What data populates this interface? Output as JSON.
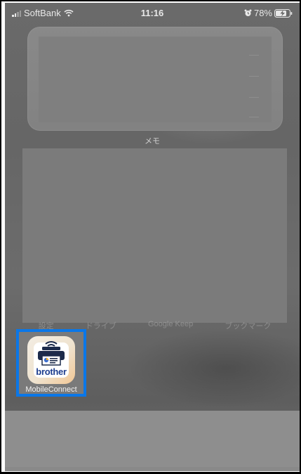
{
  "status_bar": {
    "carrier": "SoftBank",
    "time": "11:16",
    "battery_percent": "78%",
    "signal_bars_filled": 2,
    "signal_bars_total": 4,
    "icons": [
      "signal-icon",
      "wifi-icon",
      "alarm-icon",
      "battery-charging-icon"
    ]
  },
  "widgets": {
    "memo": {
      "label": "メモ"
    }
  },
  "app_row_labels": [
    "設定",
    "ドライブ",
    "Google Keep",
    "ブックマーク"
  ],
  "apps": [
    {
      "name": "MobileConnect",
      "brand_text": "brother",
      "icon": "brother-printer-icon",
      "selected": true
    }
  ],
  "colors": {
    "selection_border": "#0a77e8",
    "brand_blue": "#1e3e8f"
  }
}
